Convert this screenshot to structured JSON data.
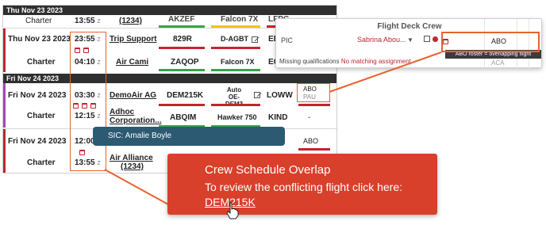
{
  "days": {
    "day1": "Thu Nov 23 2023",
    "day2": "Fri Nov 24 2023"
  },
  "top_partial": {
    "type": "Charter",
    "time": "13:55",
    "z": "Z",
    "customer": "(1234)",
    "tail": "AKZEF",
    "aircraft": "Falcon 7X",
    "airport": "LFPG"
  },
  "rows": [
    {
      "date": "Thu Nov 23 2023",
      "time_dep": "23:55",
      "z": "Z",
      "customer": "Trip Support",
      "tail": "829R",
      "aircraft": "D-AGBT",
      "airport": "EDD",
      "type": "Charter",
      "time_arr": "04:10",
      "customer2": "Air Cami",
      "tail2": "ZAQOP",
      "aircraft2": "Falcon 7X",
      "airport2": "EGA"
    },
    {
      "date": "Fri Nov 24 2023",
      "time_dep": "03:30",
      "z": "Z",
      "customer": "DemoAir AG",
      "tail": "DEM215K",
      "aircraft": "Auto OE-DEM3",
      "airport": "LOWW",
      "crew": "ABO",
      "crew2": "PAU",
      "type": "Charter",
      "time_arr": "12:15",
      "customer2": "Adhoc Corporation...",
      "tail2": "ABQIM",
      "aircraft2": "Hawker 750",
      "airport2": "KIND",
      "crew3": "-"
    },
    {
      "date": "Fri Nov 24 2023",
      "time_dep": "12:00",
      "crew": "ABO",
      "type": "Charter",
      "time_arr": "13:55",
      "z": "Z",
      "customer2": "Air Alliance",
      "customer2b": "(1234)",
      "crew3": "-"
    }
  ],
  "crew_panel": {
    "title": "Flight Deck Crew",
    "pic_label": "PIC",
    "pic_name": "Sabrina Abou...",
    "pic_code": "ABO",
    "tooltip": "ABO roster = overlapping flight",
    "aca": "ACA",
    "missing_label": "Missing qualifications",
    "missing_value": "No matching assignment"
  },
  "sic_tooltip": "SIC: Amalie Boyle",
  "callout": {
    "title": "Crew Schedule Overlap",
    "body": "To review the conflicting flight click here:",
    "link": "DEM215K"
  },
  "colors": {
    "highlight": "#e8622d",
    "callout_bg": "#d8402b",
    "sic_bg": "#2c5a73",
    "alert_red": "#c0262f"
  }
}
